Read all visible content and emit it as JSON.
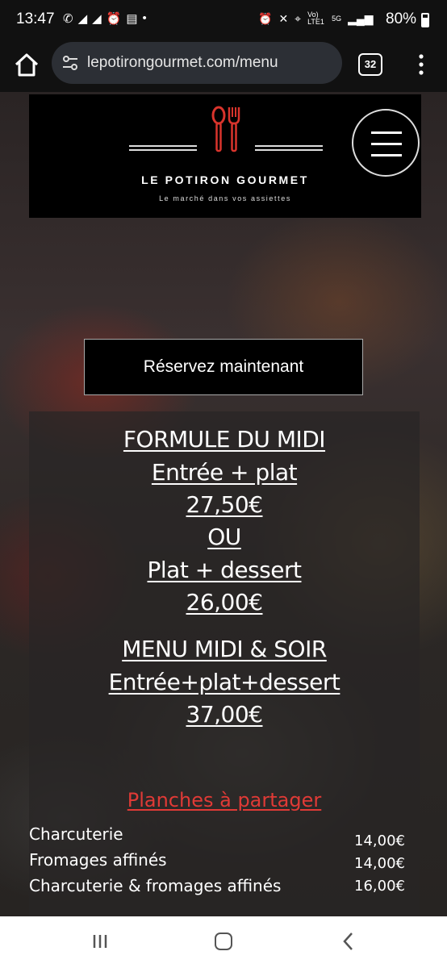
{
  "status_bar": {
    "time": "13:47",
    "left_icons": [
      "whatsapp-icon",
      "send-icon",
      "send-icon",
      "alarm-icon",
      "news-icon",
      "dot"
    ],
    "network": "Vo) LTE1",
    "signal_label": "5G",
    "battery": "80%"
  },
  "browser": {
    "url": "lepotirongourmet.com/menu",
    "tab_count": "32"
  },
  "header": {
    "brand": "LE POTIRON GOURMET",
    "tagline": "Le marché dans vos assiettes",
    "logo_color": "#d9342c"
  },
  "reserve_button": "Réservez maintenant",
  "formulas": {
    "line1": "FORMULE DU MIDI",
    "line2": "Entrée + plat",
    "line3": "27,50€",
    "line4": "OU",
    "line5": "Plat + dessert",
    "line6": "26,00€",
    "line7": "MENU MIDI & SOIR",
    "line8": "Entrée+plat+dessert",
    "line9": "37,00€"
  },
  "planches": {
    "title": "Planches à partager",
    "title_color": "#e03a36",
    "items": [
      {
        "name": "Charcuterie",
        "price": "14,00€"
      },
      {
        "name": "Fromages affinés",
        "price": "14,00€"
      },
      {
        "name": "Charcuterie & fromages affinés",
        "price": "16,00€"
      }
    ]
  }
}
